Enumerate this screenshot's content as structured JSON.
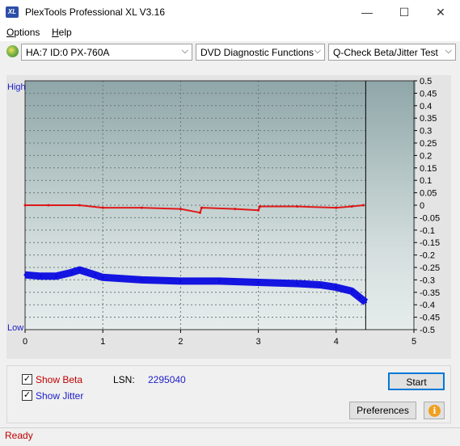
{
  "window": {
    "title": "PlexTools Professional XL V3.16",
    "logo_text": "XL",
    "minimize_glyph": "—",
    "maximize_glyph": "☐",
    "close_glyph": "✕"
  },
  "menu": [
    {
      "label": "Options",
      "underline": "O"
    },
    {
      "label": "Help",
      "underline": "H"
    }
  ],
  "toolbar": {
    "drive": "HA:7 ID:0  PX-760A",
    "function": "DVD Diagnostic Functions",
    "test": "Q-Check Beta/Jitter Test",
    "arrow": "⌵"
  },
  "chart_data": {
    "type": "line",
    "y_left_top_label": "High",
    "y_left_bottom_label": "Low",
    "xlim": [
      0,
      5
    ],
    "ylim": [
      -0.5,
      0.5
    ],
    "x_ticks": [
      "0",
      "1",
      "2",
      "3",
      "4",
      "5"
    ],
    "y_ticks": [
      "0.5",
      "0.45",
      "0.4",
      "0.35",
      "0.3",
      "0.25",
      "0.2",
      "0.15",
      "0.1",
      "0.05",
      "0",
      "-0.05",
      "-0.1",
      "-0.15",
      "-0.2",
      "-0.25",
      "-0.3",
      "-0.35",
      "-0.4",
      "-0.45",
      "-0.5"
    ],
    "grid": true,
    "end_marker_x": 4.38,
    "series": [
      {
        "key": "beta",
        "color": "#e01010",
        "x": [
          0,
          0.3,
          0.7,
          1.0,
          1.5,
          2.0,
          2.25,
          2.27,
          2.7,
          3.0,
          3.02,
          3.5,
          4.0,
          4.2,
          4.35
        ],
        "y": [
          0.0,
          0.0,
          0.0,
          -0.01,
          -0.01,
          -0.015,
          -0.03,
          -0.01,
          -0.015,
          -0.02,
          -0.005,
          -0.005,
          -0.01,
          -0.005,
          0.0
        ]
      },
      {
        "key": "jitter",
        "color": "#0a0ae0",
        "x": [
          0,
          0.2,
          0.4,
          0.6,
          0.7,
          0.9,
          1.0,
          1.5,
          2.0,
          2.5,
          3.0,
          3.5,
          3.8,
          4.0,
          4.2,
          4.3,
          4.38
        ],
        "y": [
          -0.28,
          -0.285,
          -0.285,
          -0.27,
          -0.26,
          -0.28,
          -0.29,
          -0.3,
          -0.305,
          -0.305,
          -0.31,
          -0.315,
          -0.32,
          -0.33,
          -0.345,
          -0.37,
          -0.39
        ]
      }
    ]
  },
  "controls": {
    "show_beta": {
      "label": "Show Beta",
      "checked": true,
      "color": "#c00000"
    },
    "show_jitter": {
      "label": "Show Jitter",
      "checked": true,
      "color": "#1c1cc8"
    },
    "lsn_label": "LSN:",
    "lsn_value": "2295040",
    "start_label": "Start",
    "preferences_label": "Preferences",
    "info_glyph": "i",
    "checkmark": "✓"
  },
  "status": {
    "text": "Ready"
  }
}
